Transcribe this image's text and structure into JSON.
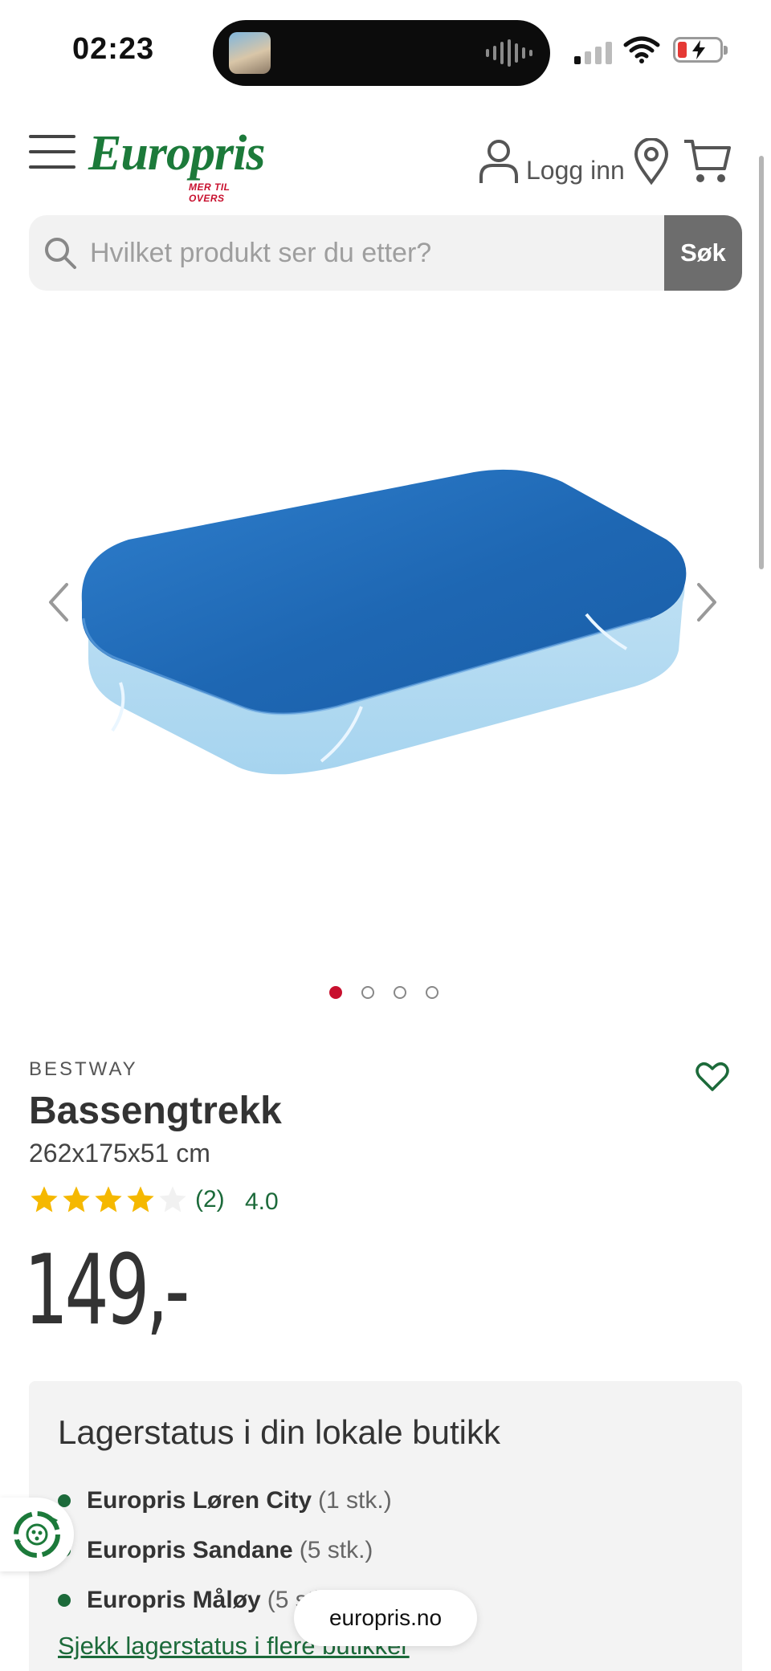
{
  "status_bar": {
    "time": "02:23"
  },
  "header": {
    "logo_text": "Europris",
    "logo_tagline": "MER TIL OVERS",
    "login_label": "Logg inn"
  },
  "search": {
    "placeholder": "Hvilket produkt ser du etter?",
    "button_label": "Søk"
  },
  "gallery": {
    "image_count": 4,
    "active_index": 0
  },
  "product": {
    "brand": "BESTWAY",
    "title": "Bassengtrekk",
    "size": "262x175x51 cm",
    "rating": {
      "stars_filled": 4,
      "stars_total": 5,
      "review_count": "(2)",
      "value": "4.0"
    },
    "price": "149,-"
  },
  "stock": {
    "heading": "Lagerstatus i din lokale butikk",
    "stores": [
      {
        "name": "Europris Løren City",
        "qty": "(1 stk.)"
      },
      {
        "name": "Europris Sandane",
        "qty": "(5 stk.)"
      },
      {
        "name": "Europris Måløy",
        "qty": "(5 stk.)"
      }
    ],
    "link_label": "Sjekk lagerstatus i flere butikker"
  },
  "browser": {
    "url": "europris.no"
  },
  "colors": {
    "brand_green": "#1c7a3a",
    "accent_red": "#c8102e",
    "link_green": "#1c6a3a",
    "star_yellow": "#f5b800"
  }
}
